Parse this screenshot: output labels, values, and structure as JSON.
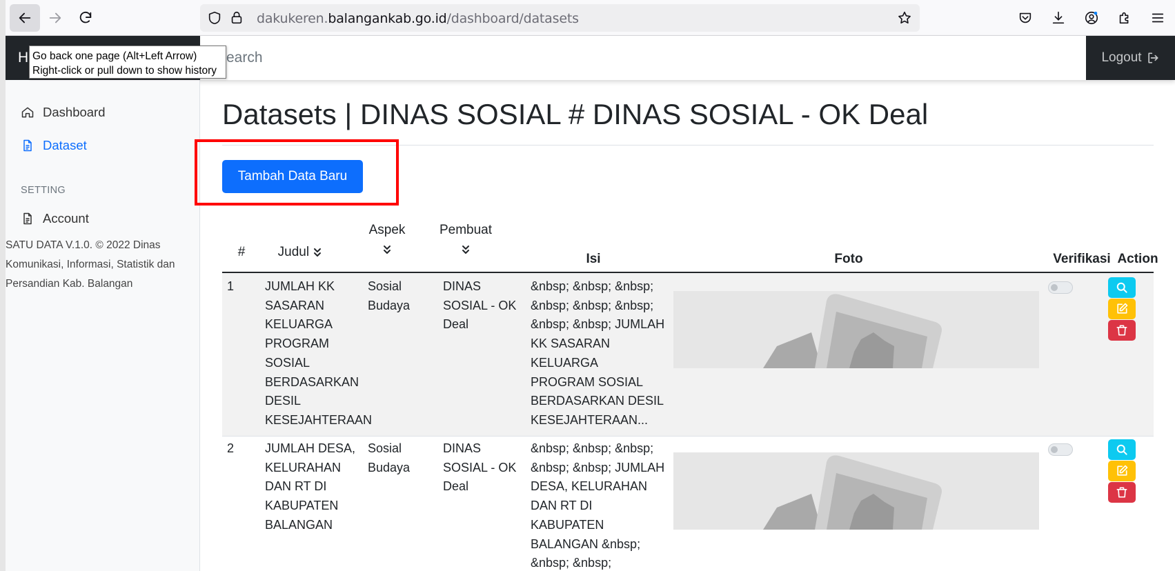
{
  "browser": {
    "url_prefix": "dakukeren.",
    "url_domain": "balangankab.go.id",
    "url_path": "/dashboard/datasets",
    "tooltip_line1": "Go back one page (Alt+Left Arrow)",
    "tooltip_line2": "Right-click or pull down to show history"
  },
  "header": {
    "brand": "H",
    "search_placeholder": "Search",
    "logout_label": "Logout"
  },
  "sidebar": {
    "items": [
      {
        "label": "Dashboard",
        "icon": "house-icon"
      },
      {
        "label": "Dataset",
        "icon": "file-text-icon",
        "active": true
      }
    ],
    "setting_heading": "SETTING",
    "setting_items": [
      {
        "label": "Account",
        "icon": "file-text-icon"
      }
    ],
    "footer": "SATU DATA V.1.0. © 2022 Dinas Komunikasi, Informasi, Statistik dan Persandian Kab. Balangan"
  },
  "main": {
    "title": "Datasets | DINAS SOSIAL # DINAS SOSIAL - OK Deal",
    "add_button": "Tambah Data Baru"
  },
  "table": {
    "headers": {
      "no": "#",
      "judul": "Judul",
      "aspek": "Aspek",
      "pembuat": "Pembuat",
      "isi": "Isi",
      "foto": "Foto",
      "verifikasi": "Verifikasi",
      "action": "Action"
    },
    "rows": [
      {
        "no": "1",
        "judul": "JUMLAH KK SASARAN KELUARGA PROGRAM SOSIAL BERDASARKAN DESIL KESEJAHTERAAN",
        "aspek": "Sosial Budaya",
        "pembuat": "DINAS SOSIAL - OK Deal",
        "isi": "&nbsp; &nbsp; &nbsp; &nbsp; &nbsp; &nbsp; &nbsp; &nbsp; JUMLAH KK SASARAN KELUARGA PROGRAM SOSIAL BERDASARKAN DESIL KESEJAHTERAAN...",
        "verified": false
      },
      {
        "no": "2",
        "judul": "JUMLAH DESA, KELURAHAN DAN RT DI KABUPATEN BALANGAN",
        "aspek": "Sosial Budaya",
        "pembuat": "DINAS SOSIAL - OK Deal",
        "isi": "&nbsp; &nbsp; &nbsp; &nbsp; &nbsp; JUMLAH DESA, KELURAHAN DAN RT DI KABUPATEN BALANGAN &nbsp; &nbsp; &nbsp;",
        "verified": false
      }
    ]
  },
  "colors": {
    "primary": "#0d6efd",
    "info": "#0dcaf0",
    "warning": "#ffc107",
    "danger": "#dc3545",
    "dark": "#212529",
    "highlight": "#ff0000"
  }
}
